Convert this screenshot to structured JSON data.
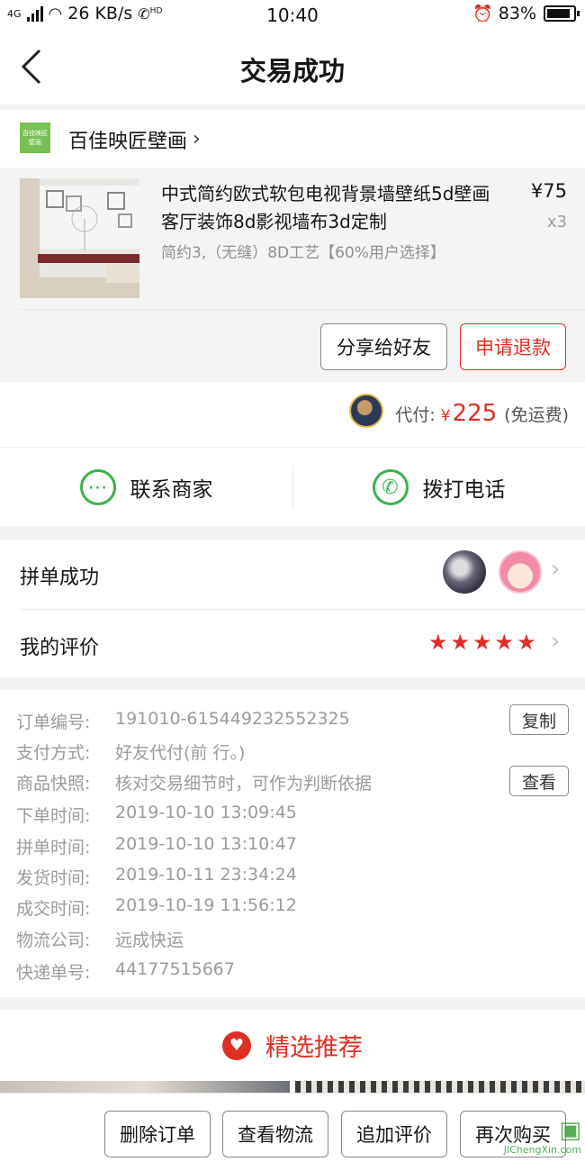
{
  "status_bar": {
    "signal": "4G",
    "speed": "26 KB/s",
    "hd": "HD",
    "time": "10:40",
    "battery": "83%"
  },
  "header": {
    "title": "交易成功"
  },
  "shop": {
    "logo_text": "百佳映匠壁画",
    "name": "百佳映匠壁画"
  },
  "product": {
    "title": "中式简约欧式软包电视背景墙壁纸5d壁画客厅装饰8d影视墙布3d定制",
    "spec": "简约3,（无缝）8D工艺【60%用户选择】",
    "price": "¥75",
    "qty": "x3",
    "share_label": "分享给好友",
    "refund_label": "申请退款"
  },
  "payment": {
    "label": "代付:",
    "currency": "¥",
    "amount": "225",
    "note": "(免运费)"
  },
  "contact": {
    "merchant_label": "联系商家",
    "call_label": "拨打电话"
  },
  "group": {
    "label": "拼单成功"
  },
  "review": {
    "label": "我的评价",
    "stars": 5
  },
  "order_info": {
    "rows": [
      {
        "key": "订单编号:",
        "value": "191010-615449232552325"
      },
      {
        "key": "支付方式:",
        "value": "好友代付(前 行。)"
      },
      {
        "key": "商品快照:",
        "value": "核对交易细节时，可作为判断依据"
      },
      {
        "key": "下单时间:",
        "value": "2019-10-10 13:09:45"
      },
      {
        "key": "拼单时间:",
        "value": "2019-10-10 13:10:47"
      },
      {
        "key": "发货时间:",
        "value": "2019-10-11 23:34:24"
      },
      {
        "key": "成交时间:",
        "value": "2019-10-19 11:56:12"
      },
      {
        "key": "物流公司:",
        "value": "远成快运"
      },
      {
        "key": "快递单号:",
        "value": "44177515667"
      }
    ],
    "copy_label": "复制",
    "view_label": "查看"
  },
  "recommend": {
    "title": "精选推荐"
  },
  "bottom_bar": {
    "delete_label": "删除订单",
    "logistics_label": "查看物流",
    "add_review_label": "追加评价",
    "rebuy_label": "再次购买"
  },
  "watermark": {
    "text": "JiChengXin.com"
  },
  "colors": {
    "accent": "#e02e24",
    "green": "#3bb24a"
  }
}
